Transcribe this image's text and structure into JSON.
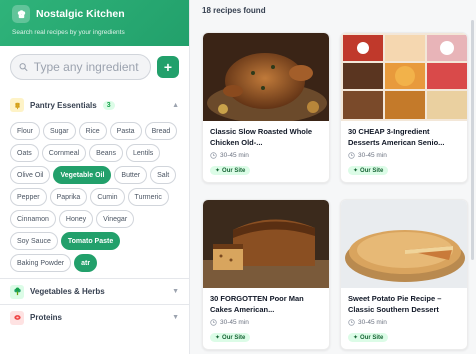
{
  "brand": {
    "title": "Nostalgic Kitchen",
    "subtitle": "Search real recipes by your ingredients"
  },
  "search": {
    "placeholder": "Type any ingredient &",
    "add_label": "+"
  },
  "pantry": {
    "label": "Pantry Essentials",
    "count": "3",
    "chips": [
      {
        "label": "Flour",
        "active": false
      },
      {
        "label": "Sugar",
        "active": false
      },
      {
        "label": "Rice",
        "active": false
      },
      {
        "label": "Pasta",
        "active": false
      },
      {
        "label": "Bread",
        "active": false
      },
      {
        "label": "Oats",
        "active": false
      },
      {
        "label": "Cornmeal",
        "active": false
      },
      {
        "label": "Beans",
        "active": false
      },
      {
        "label": "Lentils",
        "active": false
      },
      {
        "label": "Olive Oil",
        "active": false
      },
      {
        "label": "Vegetable Oil",
        "active": true
      },
      {
        "label": "Butter",
        "active": false
      },
      {
        "label": "Salt",
        "active": false
      },
      {
        "label": "Pepper",
        "active": false
      },
      {
        "label": "Paprika",
        "active": false
      },
      {
        "label": "Cumin",
        "active": false
      },
      {
        "label": "Turmeric",
        "active": false
      },
      {
        "label": "Cinnamon",
        "active": false
      },
      {
        "label": "Honey",
        "active": false
      },
      {
        "label": "Vinegar",
        "active": false
      },
      {
        "label": "Soy Sauce",
        "active": false
      },
      {
        "label": "Tomato Paste",
        "active": true
      },
      {
        "label": "Baking Powder",
        "active": false
      },
      {
        "label": "atr",
        "active": true
      }
    ]
  },
  "sections": {
    "vegetables": {
      "label": "Vegetables & Herbs"
    },
    "proteins": {
      "label": "Proteins"
    }
  },
  "results": {
    "count_text": "18 recipes found"
  },
  "recipes": [
    {
      "title": "Classic Slow Roasted Whole Chicken Old-...",
      "time": "30-45 min",
      "tag": "Our Site"
    },
    {
      "title": "30 CHEAP 3-Ingredient Desserts American Senio...",
      "time": "30-45 min",
      "tag": "Our Site"
    },
    {
      "title": "30 FORGOTTEN Poor Man Cakes American...",
      "time": "30-45 min",
      "tag": "Our Site"
    },
    {
      "title": "Sweet Potato Pie Recipe – Classic Southern Dessert",
      "time": "30-45 min",
      "tag": "Our Site"
    }
  ]
}
